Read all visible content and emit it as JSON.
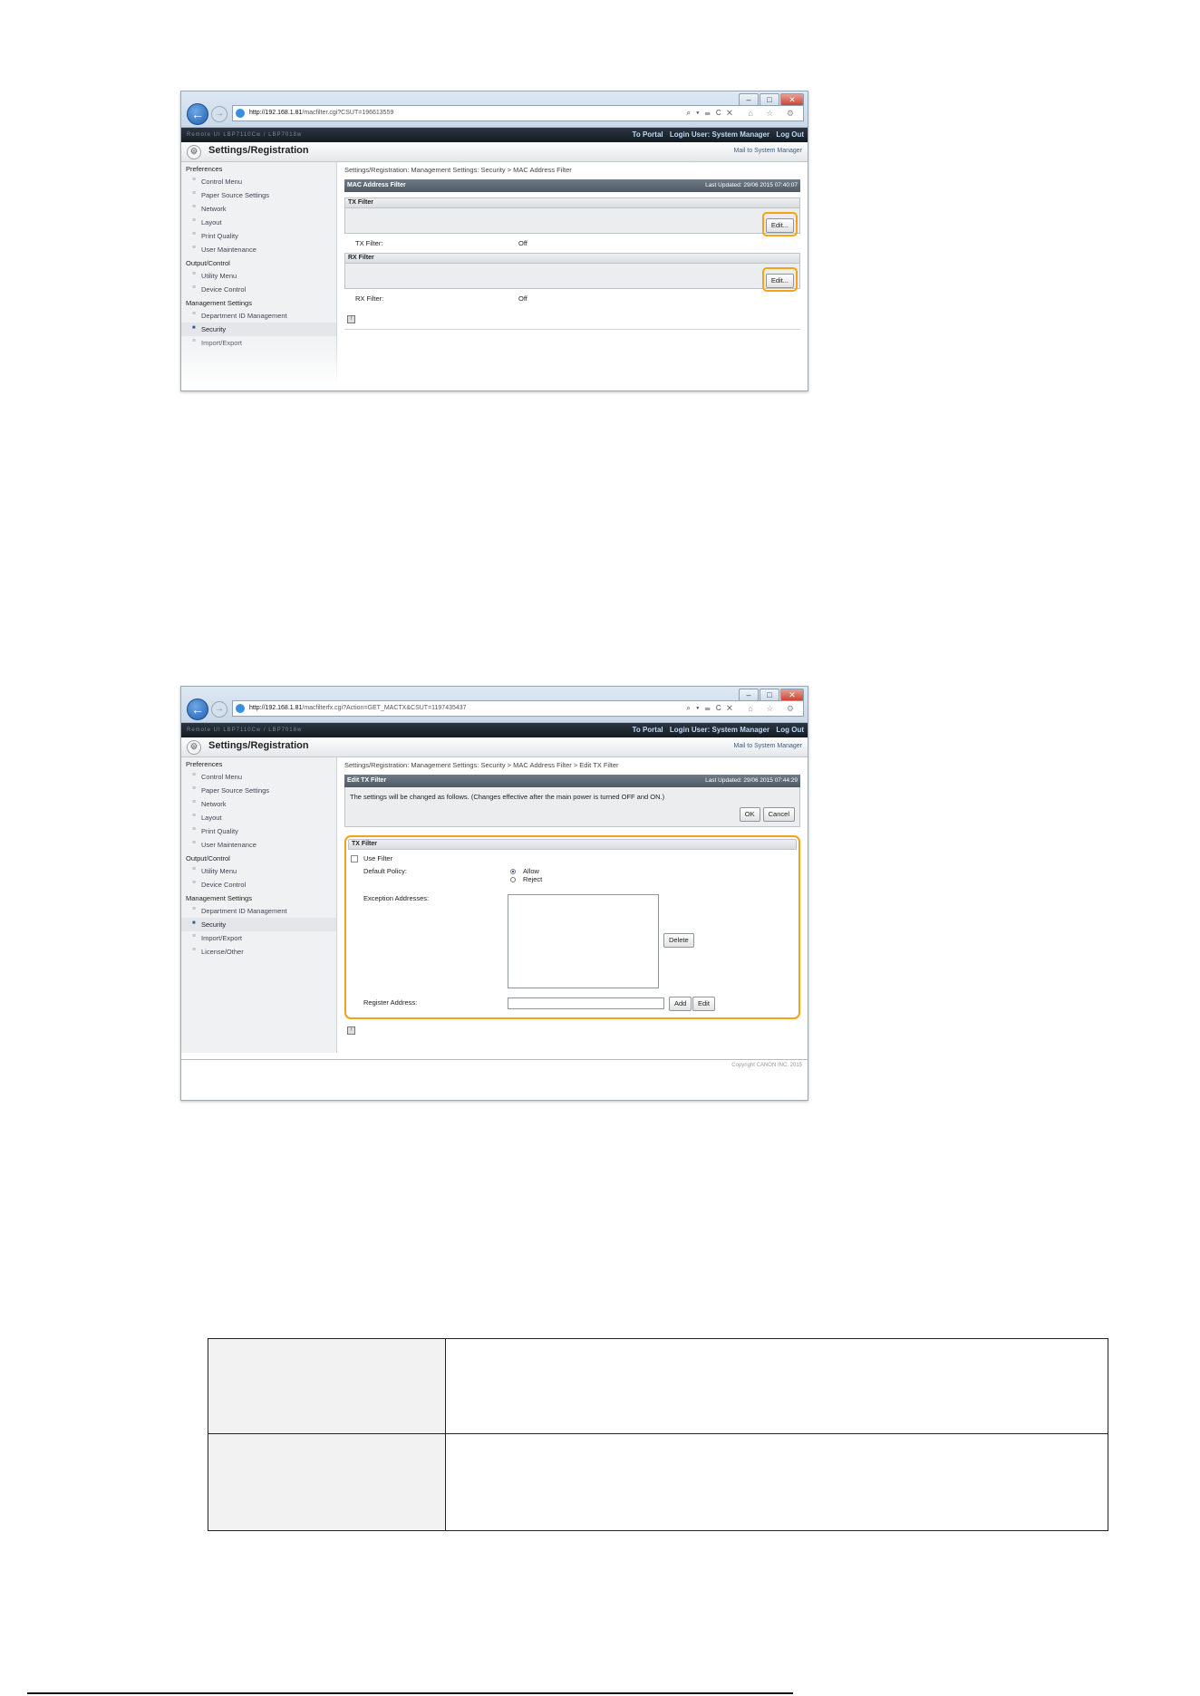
{
  "browser": {
    "window_controls": [
      "–",
      "□",
      "✕"
    ],
    "nav_back_glyph": "←",
    "nav_forward_glyph": "→",
    "toolbar_icons": "⌕ ▾ ☰ C ✕",
    "toolbar_right": "⌂ ☆ ⚙"
  },
  "app": {
    "darkbar_left": "Remote UI    LBP7110Cw / LBP7018w",
    "to_portal": "To Portal",
    "login_user": "Login User: System Manager",
    "log_out": "Log Out",
    "title": "Settings/Registration",
    "mail": "Mail to System Manager",
    "gear_glyph": "⚙"
  },
  "sidebar": {
    "groups": [
      {
        "label": "Preferences",
        "items": [
          "Control Menu",
          "Paper Source Settings",
          "Network",
          "Layout",
          "Print Quality",
          "User Maintenance"
        ]
      },
      {
        "label": "Output/Control",
        "items": [
          "Utility Menu",
          "Device Control"
        ]
      },
      {
        "label": "Management Settings",
        "items": [
          "Department ID Management",
          "Security",
          "Import/Export",
          "License/Other"
        ]
      }
    ]
  },
  "window1": {
    "url_host": "http://192.168.1.81",
    "url_path": "/macfilter.cgi?CSUT=196613559",
    "breadcrumb": "Settings/Registration: Management Settings: Security > MAC Address Filter",
    "panel_title": "MAC Address Filter",
    "last_updated": "Last Updated: 29/06 2015 07:40:07",
    "tx_section": "TX Filter",
    "edit_label": "Edit...",
    "tx_key": "TX Filter:",
    "tx_value": "Off",
    "rx_section": "RX Filter",
    "rx_key": "RX Filter:",
    "rx_value": "Off",
    "page_icon": "↑",
    "last_visible_item": "Import/Export"
  },
  "window2": {
    "url_host": "http://192.168.1.81",
    "url_path": "/macfilterfx.cgi?Action=GET_MACTX&CSUT=1197435437",
    "breadcrumb": "Settings/Registration: Management Settings: Security > MAC Address Filter > Edit TX Filter",
    "panel_title": "Edit TX Filter",
    "last_updated": "Last Updated: 29/06 2015 07:44:29",
    "info": "The settings will be changed as follows. (Changes effective after the main power is turned OFF and ON.)",
    "ok_label": "OK",
    "cancel_label": "Cancel",
    "section": "TX Filter",
    "use_filter": "Use Filter",
    "default_policy": "Default Policy:",
    "allow": "Allow",
    "reject": "Reject",
    "exception_addresses": "Exception Addresses:",
    "delete_label": "Delete",
    "register_address": "Register Address:",
    "register_value": "",
    "add_label": "Add",
    "edit_label": "Edit",
    "page_icon": "↑",
    "copyright": "Copyright CANON INC. 2015"
  },
  "table": {
    "rows": [
      {
        "c1": "",
        "c2": ""
      },
      {
        "c1": "",
        "c2": ""
      }
    ]
  }
}
